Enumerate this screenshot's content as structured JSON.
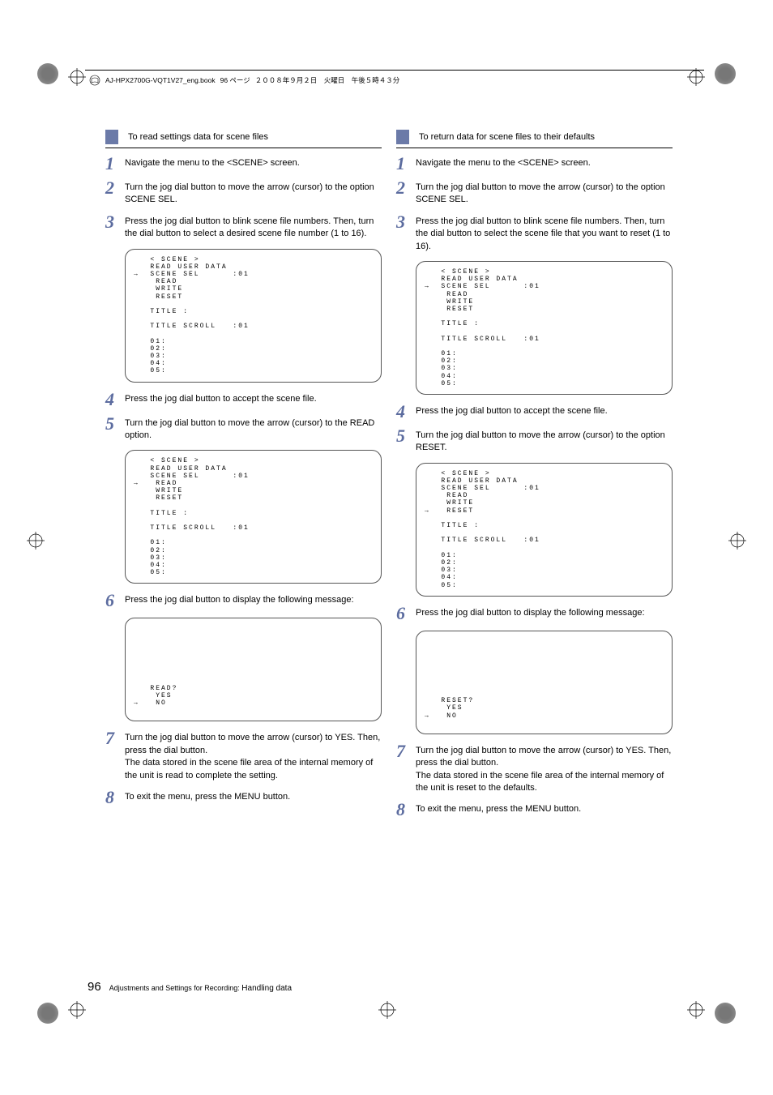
{
  "header": {
    "filename": "AJ-HPX2700G-VQT1V27_eng.book",
    "page_label": "96 ページ",
    "date_jp": "２００８年９月２日　火曜日　午後５時４３分"
  },
  "left": {
    "heading": "To read settings data for scene files",
    "steps": {
      "s1": "Navigate the menu to the <SCENE> screen.",
      "s2": "Turn the jog dial button to move the arrow (cursor) to the option SCENE SEL.",
      "s3": "Press the jog dial button to blink scene file numbers. Then, turn the dial button to select a desired scene file number (1 to 16).",
      "s4": "Press the jog dial button to accept the scene file.",
      "s5": "Turn the jog dial button to move the arrow (cursor) to the READ option.",
      "s6": "Press the jog dial button to display the following message:",
      "s7": "Turn the jog dial button to move the arrow (cursor) to YES. Then, press the dial button.\nThe data stored in the scene file area of the internal memory of the unit is read to complete the setting.",
      "s8": "To exit the menu, press the MENU button."
    },
    "code1": "   < SCENE >\n   READ USER DATA\n→  SCENE SEL      :01\n    READ\n    WRITE\n    RESET\n\n   TITLE :\n\n   TITLE SCROLL   :01\n\n   01:\n   02:\n   03:\n   04:\n   05:",
    "code2": "   < SCENE >\n   READ USER DATA\n   SCENE SEL      :01\n→   READ\n    WRITE\n    RESET\n\n   TITLE :\n\n   TITLE SCROLL   :01\n\n   01:\n   02:\n   03:\n   04:\n   05:",
    "code3": "\n\n\n\n\n\n\n\n   READ?\n    YES\n→   NO"
  },
  "right": {
    "heading": "To return data for scene files to their defaults",
    "steps": {
      "s1": "Navigate the menu to the <SCENE> screen.",
      "s2": "Turn the jog dial button to move the arrow (cursor) to the option SCENE SEL.",
      "s3": "Press the jog dial button to blink scene file numbers. Then, turn the dial button to select the scene file that you want to reset (1 to 16).",
      "s4": "Press the jog dial button to accept the scene file.",
      "s5": "Turn the jog dial button to move the arrow (cursor) to the option RESET.",
      "s6": "Press the jog dial button to display the following message:",
      "s7": "Turn the jog dial button to move the arrow (cursor) to YES. Then, press the dial button.\nThe data stored in the scene file area of the internal memory of the unit is reset to the defaults.",
      "s8": "To exit the menu, press the MENU button."
    },
    "code1": "   < SCENE >\n   READ USER DATA\n→  SCENE SEL      :01\n    READ\n    WRITE\n    RESET\n\n   TITLE :\n\n   TITLE SCROLL   :01\n\n   01:\n   02:\n   03:\n   04:\n   05:",
    "code2": "   < SCENE >\n   READ USER DATA\n   SCENE SEL      :01\n    READ\n    WRITE\n→   RESET\n\n   TITLE :\n\n   TITLE SCROLL   :01\n\n   01:\n   02:\n   03:\n   04:\n   05:",
    "code3": "\n\n\n\n\n\n\n\n   RESET?\n    YES\n→   NO"
  },
  "footer": {
    "page_num": "96",
    "section": "Adjustments and Settings for Recording:",
    "subsection": "Handling data"
  }
}
